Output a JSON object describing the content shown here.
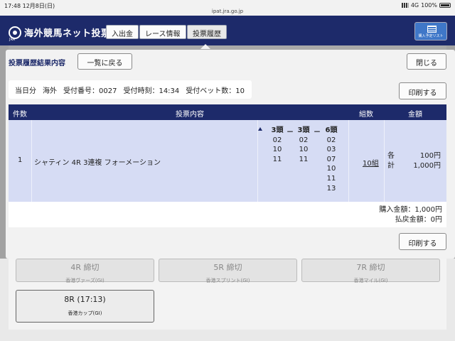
{
  "status_bar": {
    "time": "17:48",
    "date": "12月8日(日)",
    "url": "ipat.jra.go.jp",
    "network": "4G",
    "battery": "100%"
  },
  "header": {
    "logo_mark": "JRA",
    "logo_title": "海外競馬ネット投票",
    "nav": [
      "入出金",
      "レース情報",
      "投票履歴"
    ],
    "schedule_button": "購入予定リスト"
  },
  "background_races": [
    {
      "race": "4R 締切",
      "name": "香港ヴァーズ(GI)"
    },
    {
      "race": "5R 締切",
      "name": "香港スプリント(GI)"
    },
    {
      "race": "7R 締切",
      "name": "香港マイル(GI)"
    },
    {
      "race": "8R (17:13)",
      "name": "香港カップ(GI)"
    }
  ],
  "modal": {
    "title": "投票履歴結果内容",
    "back_button": "一覧に戻る",
    "close_button": "閉じる",
    "print_button": "印刷する",
    "info": {
      "day": "当日分",
      "region": "海外",
      "receipt": "受付番号：0027",
      "time": "受付時刻：14:34",
      "bets": "受付ベット数：10"
    },
    "table": {
      "headers": [
        "件数",
        "投票内容",
        "組数",
        "金額"
      ],
      "row": {
        "index": "1",
        "content": "シャティン 4R 3連複 フォーメーション",
        "col_headers": [
          "3頭",
          "3頭",
          "6頭"
        ],
        "dash": "－",
        "col1": [
          "02",
          "10",
          "11"
        ],
        "col2": [
          "02",
          "10",
          "11"
        ],
        "col3": [
          "02",
          "03",
          "07",
          "10",
          "11",
          "13"
        ],
        "kumi": "10組",
        "amount_labels": [
          "各",
          "計"
        ],
        "amount_values": [
          "100円",
          "1,000円"
        ]
      }
    },
    "totals": {
      "purchase": "購入金額：1,000円",
      "payout": "払戻金額：0円"
    }
  }
}
